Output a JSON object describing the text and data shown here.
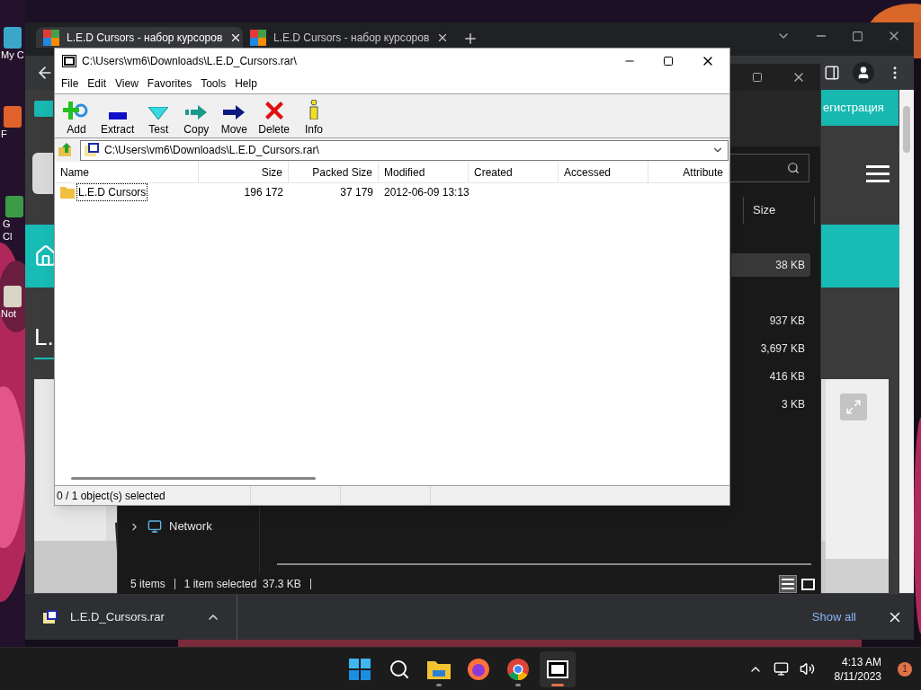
{
  "desktop": {
    "icons": [
      {
        "lines": [
          "My C"
        ]
      },
      {
        "lines": [
          "F"
        ]
      },
      {
        "lines": [
          "G",
          "Cl"
        ]
      },
      {
        "lines": [
          "Not"
        ]
      }
    ]
  },
  "browser": {
    "tabs": [
      {
        "title": "L.E.D Cursors - набор курсоров",
        "selected": true
      },
      {
        "title": "L.E.D Cursors - набор курсоров",
        "selected": false
      }
    ],
    "page": {
      "register_label": "егистрация",
      "heading": "L."
    },
    "download": {
      "file": "L.E.D_Cursors.rar",
      "show_all": "Show all"
    }
  },
  "explorer": {
    "size_header": "Size",
    "rows": [
      {
        "size": "38 KB",
        "selected": true
      },
      {
        "size": "937 KB",
        "selected": false
      },
      {
        "size": "3,697 KB",
        "selected": false
      },
      {
        "size": "416 KB",
        "selected": false
      },
      {
        "size": "3 KB",
        "selected": false
      }
    ],
    "nav": [
      {
        "label": "Network",
        "expanded": false
      }
    ],
    "status": {
      "count": "5 items",
      "selection": "1 item selected  37.3 KB"
    },
    "views": [
      {
        "kind": "details",
        "selected": true
      },
      {
        "kind": "preview",
        "selected": false
      }
    ]
  },
  "sevenzip": {
    "title": "C:\\Users\\vm6\\Downloads\\L.E.D_Cursors.rar\\",
    "menu": [
      "File",
      "Edit",
      "View",
      "Favorites",
      "Tools",
      "Help"
    ],
    "toolbar": [
      {
        "kind": "add",
        "label": "Add"
      },
      {
        "kind": "extract",
        "label": "Extract"
      },
      {
        "kind": "test",
        "label": "Test"
      },
      {
        "kind": "copy",
        "label": "Copy"
      },
      {
        "kind": "move",
        "label": "Move"
      },
      {
        "kind": "delete",
        "label": "Delete"
      },
      {
        "kind": "info",
        "label": "Info"
      }
    ],
    "address": "C:\\Users\\vm6\\Downloads\\L.E.D_Cursors.rar\\",
    "columns": [
      "Name",
      "Size",
      "Packed Size",
      "Modified",
      "Created",
      "Accessed",
      "Attribute"
    ],
    "rows": [
      {
        "cells": [
          "L.E.D Cursors",
          "196 172",
          "37 179",
          "2012-06-09 13:13"
        ],
        "focused": true
      }
    ],
    "status": "0 / 1 object(s) selected"
  },
  "taskbar": {
    "apps": [
      {
        "kind": "start",
        "running": false,
        "active": false
      },
      {
        "kind": "search",
        "running": false,
        "active": false
      },
      {
        "kind": "explorer",
        "running": true,
        "active": false
      },
      {
        "kind": "firefox",
        "running": false,
        "active": false
      },
      {
        "kind": "chrome",
        "running": true,
        "active": false
      },
      {
        "kind": "sevenzip",
        "running": true,
        "active": true
      }
    ],
    "time": "4:13 AM",
    "date": "8/11/2023",
    "badge": "1"
  }
}
